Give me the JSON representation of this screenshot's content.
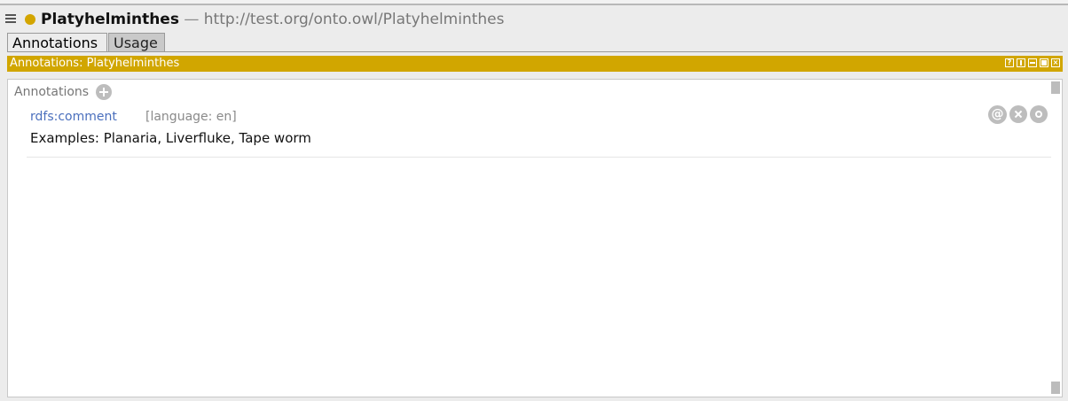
{
  "header": {
    "entity_name": "Platyhelminthes",
    "separator": "—",
    "iri": "http://test.org/onto.owl/Platyhelminthes",
    "entity_color": "#d3a500",
    "menu_icon": "hamburger-menu-icon"
  },
  "tabs": [
    {
      "label": "Annotations",
      "active": true
    },
    {
      "label": "Usage",
      "active": false
    }
  ],
  "view": {
    "title": "Annotations: Platyhelminthes",
    "bar_color": "#d1a600",
    "buttons": [
      "help-icon",
      "split-icon",
      "minimize-icon",
      "maximize-icon",
      "close-icon"
    ]
  },
  "annotations_section": {
    "label": "Annotations",
    "add_icon": "add-icon"
  },
  "annotations": [
    {
      "property": "rdfs:comment",
      "language": "[language: en]",
      "value": "Examples: Planaria, Liverfluke, Tape worm",
      "actions": {
        "at": "@",
        "x": "delete-icon",
        "o": "options-icon"
      }
    }
  ],
  "colors": {
    "property_link": "#4a6fbd",
    "muted_text": "#777777"
  }
}
